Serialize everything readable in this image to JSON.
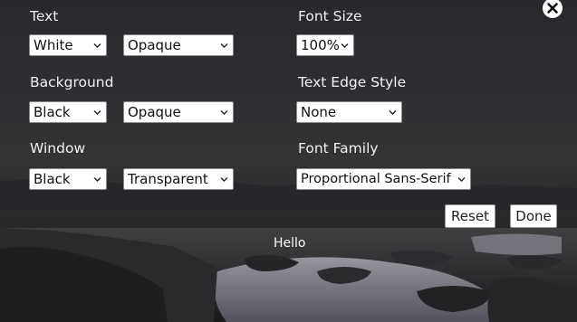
{
  "settings": {
    "text": {
      "label": "Text",
      "color": "White",
      "opacity": "Opaque"
    },
    "background": {
      "label": "Background",
      "color": "Black",
      "opacity": "Opaque"
    },
    "window": {
      "label": "Window",
      "color": "Black",
      "opacity": "Transparent"
    },
    "font_size": {
      "label": "Font Size",
      "value": "100%"
    },
    "text_edge_style": {
      "label": "Text Edge Style",
      "value": "None"
    },
    "font_family": {
      "label": "Font Family",
      "value": "Proportional Sans-Serif"
    }
  },
  "buttons": {
    "reset": "Reset",
    "done": "Done"
  },
  "caption_preview": "Hello",
  "icons": {
    "close": "close-icon",
    "dropdown": "chevron-down-icon"
  },
  "colors": {
    "overlay": "#1e1e20",
    "label_text": "#f2f2f2",
    "control_bg": "#ffffff"
  }
}
